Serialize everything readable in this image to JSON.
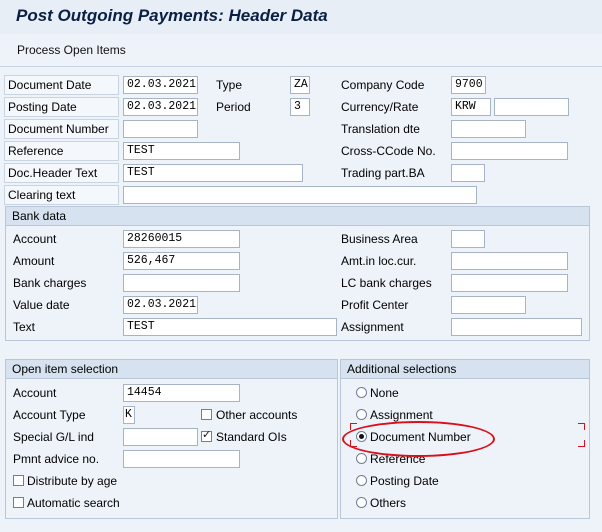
{
  "title": "Post Outgoing Payments: Header Data",
  "toolbar": {
    "process_open_items": "Process Open Items"
  },
  "header": {
    "document_date": {
      "label": "Document Date",
      "value": "02.03.2021"
    },
    "type": {
      "label": "Type",
      "value": "ZA"
    },
    "company_code": {
      "label": "Company Code",
      "value": "9700"
    },
    "posting_date": {
      "label": "Posting Date",
      "value": "02.03.2021"
    },
    "period": {
      "label": "Period",
      "value": "3"
    },
    "currency_rate": {
      "label": "Currency/Rate",
      "value": "KRW",
      "rate": ""
    },
    "document_number": {
      "label": "Document Number",
      "value": ""
    },
    "translation_dte": {
      "label": "Translation dte",
      "value": ""
    },
    "reference": {
      "label": "Reference",
      "value": "TEST"
    },
    "cross_ccode_no": {
      "label": "Cross-CCode No.",
      "value": ""
    },
    "doc_header_text": {
      "label": "Doc.Header Text",
      "value": "TEST"
    },
    "trading_part_ba": {
      "label": "Trading part.BA",
      "value": ""
    },
    "clearing_text": {
      "label": "Clearing text",
      "value": ""
    }
  },
  "bank_data": {
    "title": "Bank data",
    "account": {
      "label": "Account",
      "value": "28260015"
    },
    "business_area": {
      "label": "Business Area",
      "value": ""
    },
    "amount": {
      "label": "Amount",
      "value": "526,467"
    },
    "amt_loc_cur": {
      "label": "Amt.in loc.cur.",
      "value": ""
    },
    "bank_charges": {
      "label": "Bank charges",
      "value": ""
    },
    "lc_bank_charges": {
      "label": "LC bank charges",
      "value": ""
    },
    "value_date": {
      "label": "Value date",
      "value": "02.03.2021"
    },
    "profit_center": {
      "label": "Profit Center",
      "value": ""
    },
    "text": {
      "label": "Text",
      "value": "TEST"
    },
    "assignment": {
      "label": "Assignment",
      "value": ""
    }
  },
  "open_item_selection": {
    "title": "Open item selection",
    "account": {
      "label": "Account",
      "value": "14454"
    },
    "account_type": {
      "label": "Account Type",
      "value": "K"
    },
    "other_accounts": {
      "label": "Other accounts",
      "checked": false
    },
    "special_gl_ind": {
      "label": "Special G/L ind",
      "value": ""
    },
    "standard_ois": {
      "label": "Standard OIs",
      "checked": true
    },
    "pmnt_advice_no": {
      "label": "Pmnt advice no.",
      "value": ""
    },
    "distribute_by_age": {
      "label": "Distribute by age",
      "checked": false
    },
    "automatic_search": {
      "label": "Automatic search",
      "checked": false
    }
  },
  "additional_selections": {
    "title": "Additional selections",
    "options": [
      "None",
      "Assignment",
      "Document Number",
      "Reference",
      "Posting Date",
      "Others"
    ],
    "selected": "Document Number"
  },
  "colors": {
    "highlight_ellipse": "#d9101c",
    "title_text": "#0a1f44"
  }
}
